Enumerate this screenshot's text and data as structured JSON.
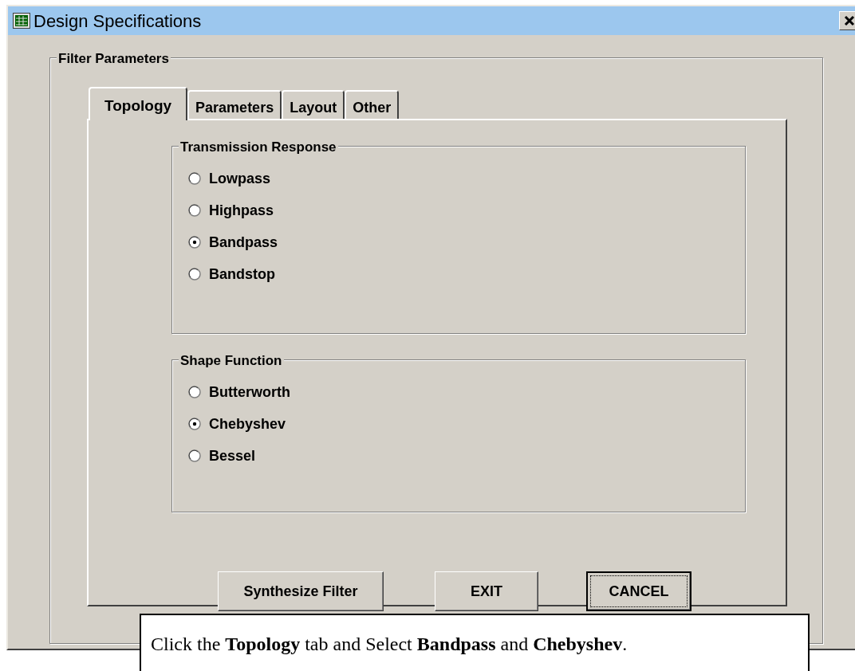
{
  "window": {
    "title": "Design Specifications"
  },
  "group": {
    "title": "Filter Parameters"
  },
  "tabs": [
    {
      "label": "Topology",
      "selected": true
    },
    {
      "label": "Parameters",
      "selected": false
    },
    {
      "label": "Layout",
      "selected": false
    },
    {
      "label": "Other",
      "selected": false
    }
  ],
  "sections": [
    {
      "title": "Transmission Response",
      "options": [
        {
          "label": "Lowpass",
          "selected": false
        },
        {
          "label": "Highpass",
          "selected": false
        },
        {
          "label": "Bandpass",
          "selected": true
        },
        {
          "label": "Bandstop",
          "selected": false
        }
      ]
    },
    {
      "title": "Shape Function",
      "options": [
        {
          "label": "Butterworth",
          "selected": false
        },
        {
          "label": "Chebyshev",
          "selected": true
        },
        {
          "label": "Bessel",
          "selected": false
        }
      ]
    }
  ],
  "buttons": [
    {
      "label": "Synthesize Filter",
      "focused": false
    },
    {
      "label": "EXIT",
      "focused": false
    },
    {
      "label": "CANCEL",
      "focused": true
    }
  ],
  "caption": "Click the **Topology** tab and Select **Bandpass** and **Chebyshev**."
}
